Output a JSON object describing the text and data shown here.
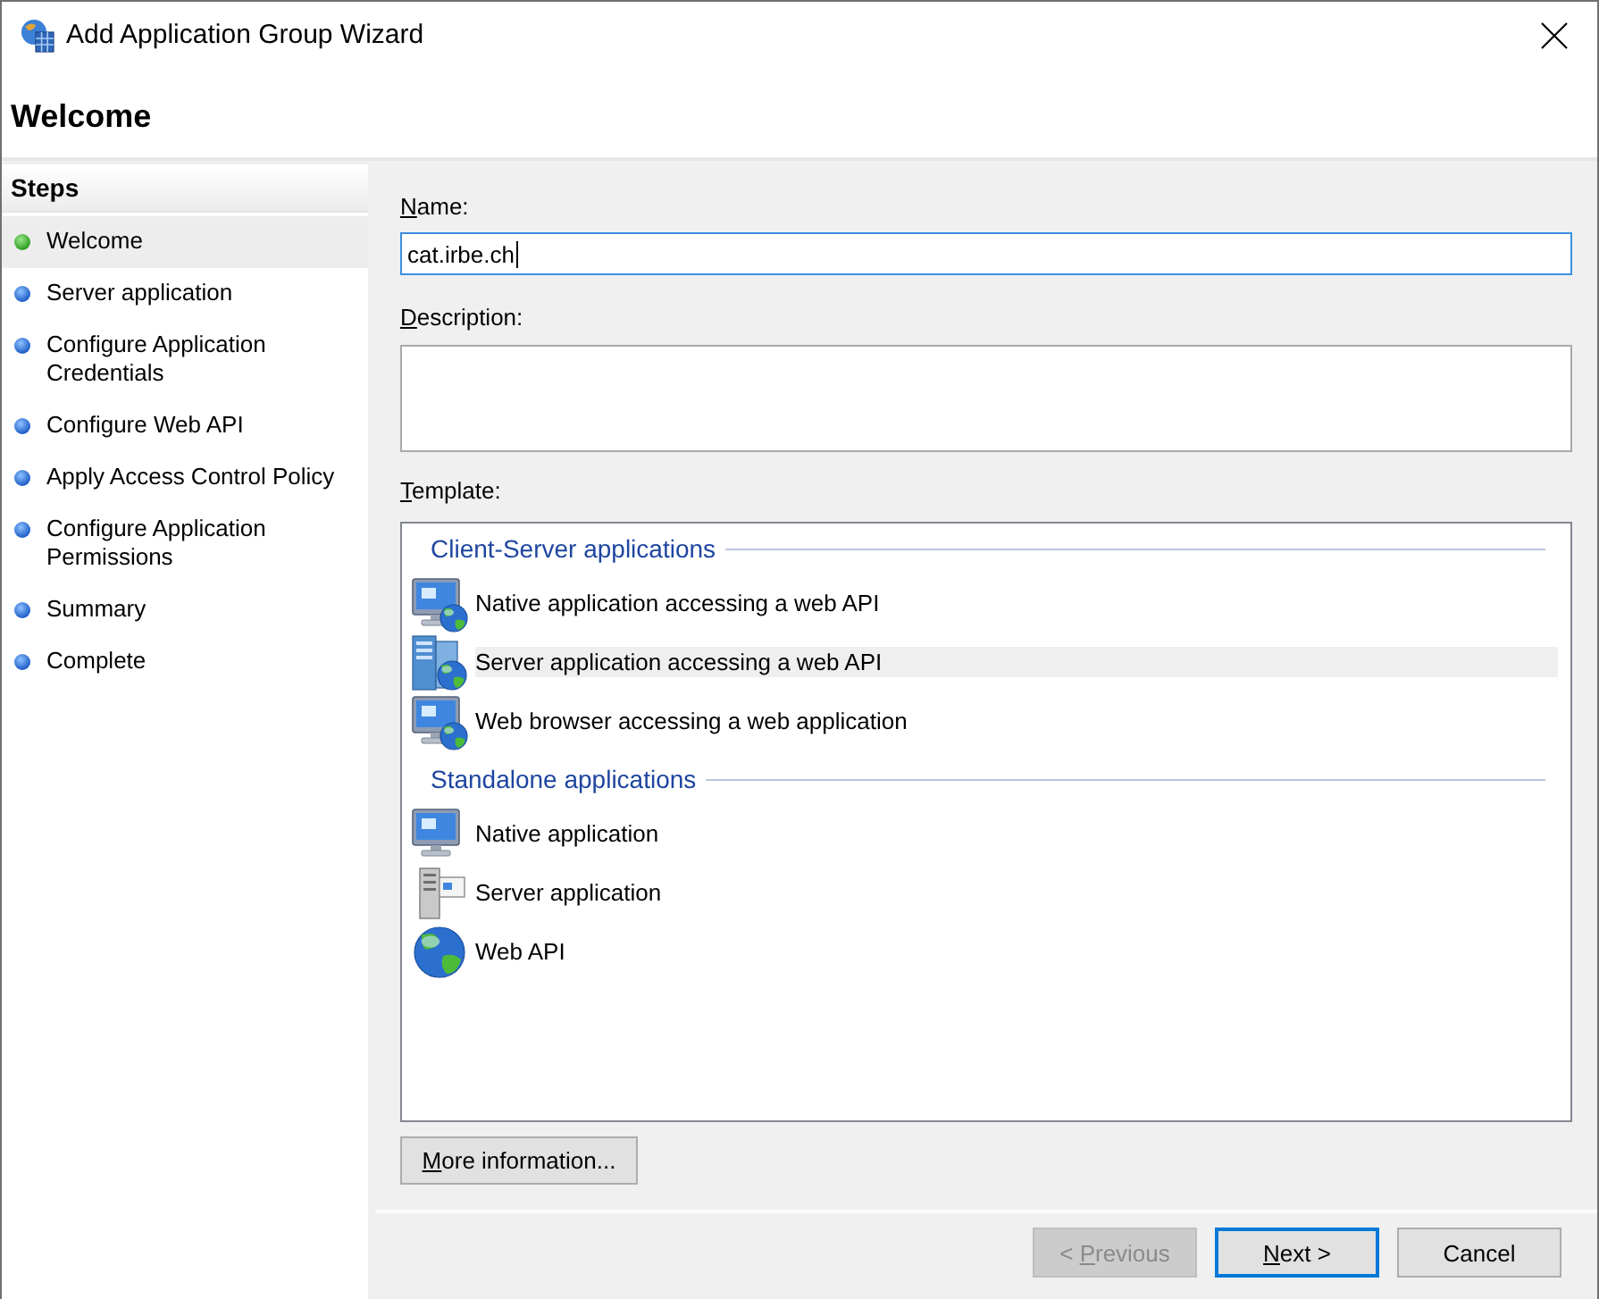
{
  "window": {
    "title": "Add Application Group Wizard"
  },
  "page_title": "Welcome",
  "steps": {
    "heading": "Steps",
    "items": [
      {
        "label": "Welcome",
        "selected": true
      },
      {
        "label": "Server application",
        "selected": false
      },
      {
        "label": "Configure Application Credentials",
        "selected": false
      },
      {
        "label": "Configure Web API",
        "selected": false
      },
      {
        "label": "Apply Access Control Policy",
        "selected": false
      },
      {
        "label": "Configure Application Permissions",
        "selected": false
      },
      {
        "label": "Summary",
        "selected": false
      },
      {
        "label": "Complete",
        "selected": false
      }
    ]
  },
  "form": {
    "name": {
      "label": {
        "key": "N",
        "rest": "ame:"
      },
      "value": "cat.irbe.ch",
      "focused": true
    },
    "description": {
      "label": {
        "key": "D",
        "rest": "escription:"
      }
    },
    "template": {
      "label": {
        "key": "T",
        "rest": "emplate:"
      },
      "groups": [
        {
          "title": "Client-Server applications",
          "items": [
            {
              "kind": "clientapi",
              "label": "Native application accessing a web API",
              "selected": false
            },
            {
              "kind": "serverapi",
              "label": "Server application accessing a web API",
              "selected": true
            },
            {
              "kind": "browser",
              "label": "Web browser accessing a web application",
              "selected": false
            }
          ]
        },
        {
          "title": "Standalone applications",
          "items": [
            {
              "kind": "native",
              "label": "Native application",
              "selected": false
            },
            {
              "kind": "server",
              "label": "Server application",
              "selected": false
            },
            {
              "kind": "webapi",
              "label": "Web API",
              "selected": false
            }
          ]
        }
      ]
    },
    "more_info_button": {
      "label": {
        "key": "M",
        "rest": "ore information..."
      }
    }
  },
  "buttons": [
    {
      "label": {
        "text": "< ",
        "key": "P",
        "rest": "revious"
      },
      "disabled": true,
      "default": false
    },
    {
      "label": {
        "key": "N",
        "rest": "ext >"
      },
      "disabled": false,
      "default": true
    },
    {
      "label": {
        "text": "Cancel"
      },
      "disabled": false,
      "default": false
    }
  ]
}
